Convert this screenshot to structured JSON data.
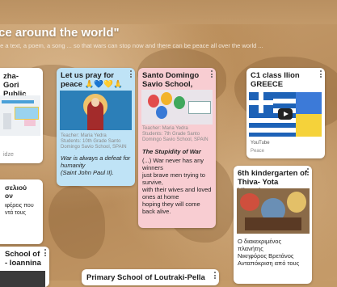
{
  "header": {
    "title": "ce around the world\"",
    "subtitle": "te a text, a poem, a song ... so that wars can stop now and there can be peace all over the world ..."
  },
  "cards": {
    "zha": {
      "title1": "zha-",
      "title2": "Gori Public",
      "footer": "idze"
    },
    "pray": {
      "title1": "Let us pray for",
      "title2": "peace 🙏💙💛🙏",
      "teacher": "Teacher: Maria Yedra",
      "students": "Students: 10th Grade Santo",
      "school": "Domingo Savio School, SPAIN",
      "quote1": "War is always a defeat for",
      "quote2": "humanity",
      "quote3": "(Saint John Paul II)."
    },
    "santo": {
      "title1": "Santo Domingo",
      "title2": "Savio School, SPAIN",
      "teacher": "Teacher: Maria Yedra",
      "students": "Students: 7th Grade Santo",
      "school": "Domingo Savio School, SPAIN",
      "heading": "The Stupidity of War",
      "lines": [
        "(...) War never has any",
        "winners",
        "just brave men trying to",
        "survive,",
        "with their wives and loved",
        "ones at home",
        "hoping they will come",
        "back alive."
      ]
    },
    "ilion": {
      "title1": "C1 class Ilion",
      "title2": "GREECE",
      "source": "YouTube",
      "caption": "Peace"
    },
    "greek1": {
      "l1": "σελιού",
      "l2": "ον",
      "l3": "ιφέρεις που",
      "l4": "ντά τους"
    },
    "thiva": {
      "title1": "6th kindergarten of",
      "title2": "Thiva- Yota Vlouchou",
      "l1": "Ο διακεκριμένος",
      "l2": "πλανήτης",
      "l3": "Νικηφόρος Βρετάνος",
      "l4": "Ανταπόκριση από τους"
    },
    "ioannina": {
      "title1": "School of",
      "title2": "- Ioannina"
    },
    "loutraki": {
      "title": "Primary School of Loutraki-Pella"
    }
  }
}
